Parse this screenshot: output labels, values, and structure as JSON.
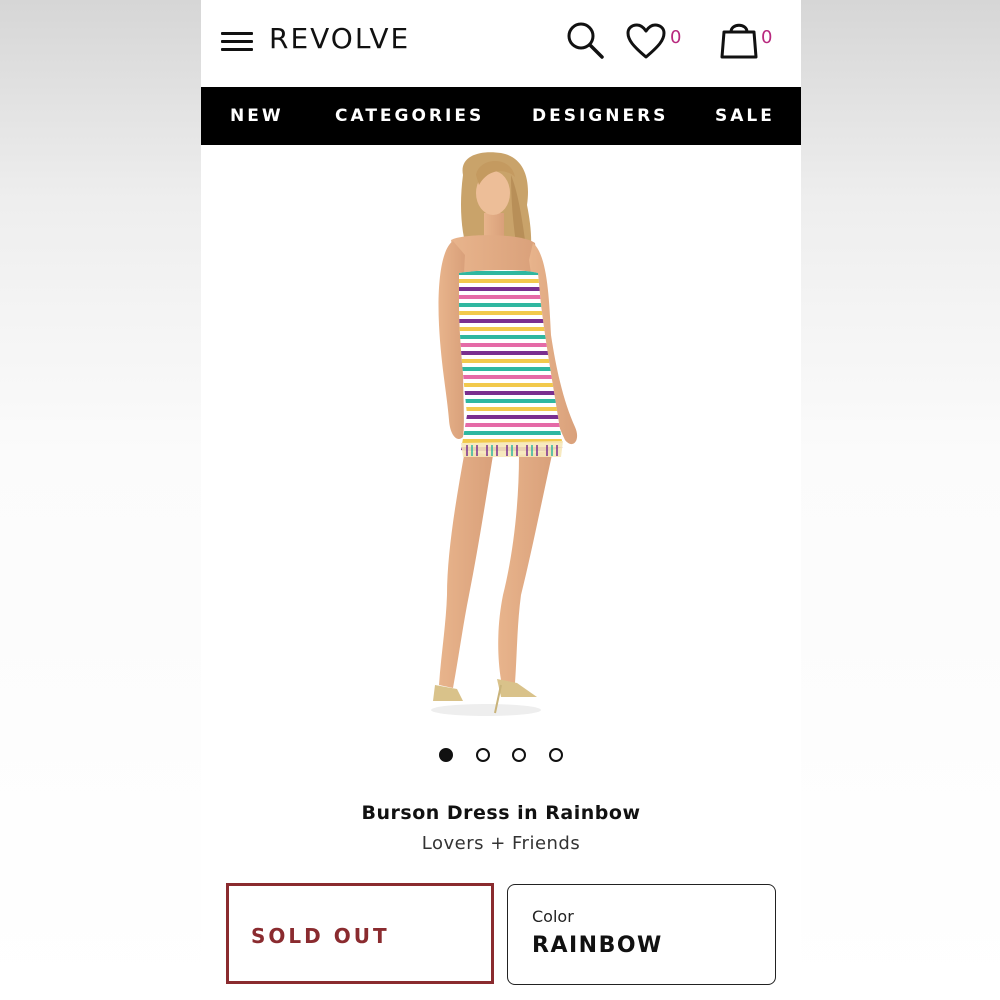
{
  "header": {
    "logo": "REVOLVE",
    "wishlist_count": "0",
    "bag_count": "0",
    "icons": [
      "menu-icon",
      "search-icon",
      "heart-icon",
      "shopping-bag-icon"
    ]
  },
  "nav": {
    "items": [
      {
        "label": "NEW"
      },
      {
        "label": "CATEGORIES"
      },
      {
        "label": "DESIGNERS"
      },
      {
        "label": "SALE"
      }
    ]
  },
  "carousel": {
    "total": 4,
    "active": 1
  },
  "product": {
    "title": "Burson Dress in Rainbow",
    "brand": "Lovers + Friends",
    "stock_status": "SOLD OUT",
    "color_label": "Color",
    "color_value": "RAINBOW"
  },
  "colors": {
    "nav_bg": "#000000",
    "count_accent": "#b8287e",
    "sold_out": "#8a2b2f",
    "stripe_colors": [
      "#7a2f8f",
      "#2fb7a0",
      "#f2c94c",
      "#e56aa7",
      "#ffffff"
    ]
  }
}
